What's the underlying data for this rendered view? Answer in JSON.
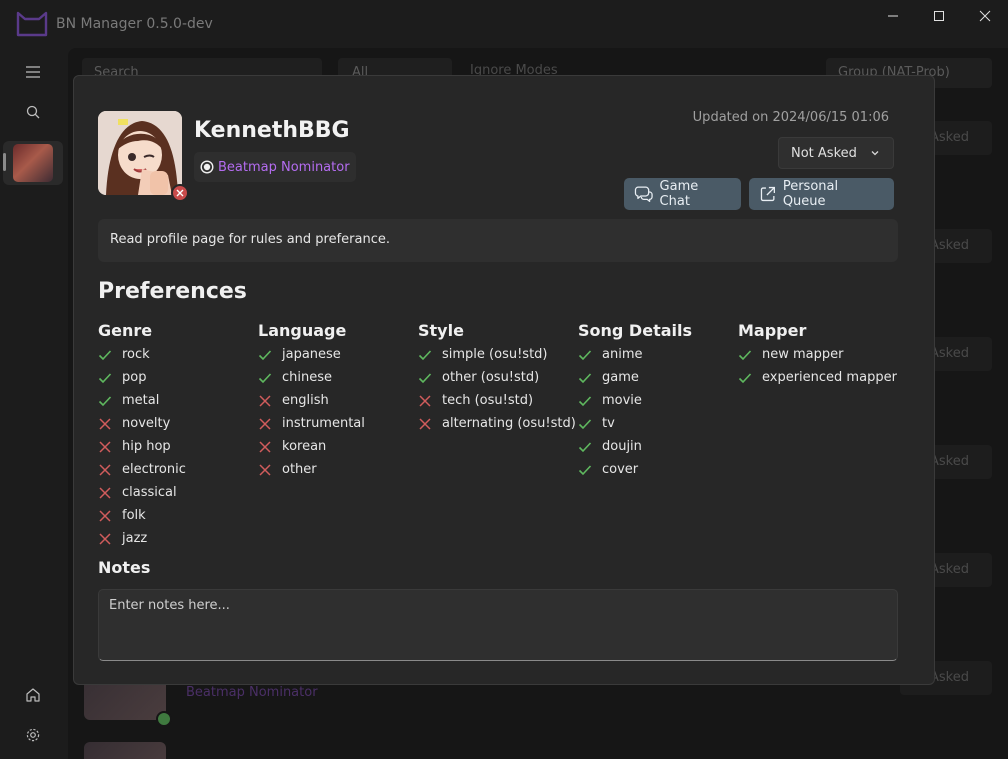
{
  "app": {
    "title": "BN Manager 0.5.0-dev"
  },
  "background": {
    "search_placeholder": "Search",
    "mode_filter": "All",
    "ignore_modes_label": "Ignore Modes",
    "group_filter": "Group (NAT-Prob)",
    "row_status_label": "Asked",
    "card_role": "Beatmap Nominator"
  },
  "profile": {
    "username": "KennethBBG",
    "role": "Beatmap Nominator",
    "updated": "Updated on 2024/06/15 01:06",
    "request_status": "Not Asked",
    "buttons": {
      "game_chat": "Game Chat",
      "personal_queue": "Personal Queue"
    },
    "bio": "Read profile page for rules and preferance."
  },
  "preferences": {
    "title": "Preferences",
    "columns": [
      {
        "name": "Genre",
        "items": [
          {
            "label": "rock",
            "ok": true
          },
          {
            "label": "pop",
            "ok": true
          },
          {
            "label": "metal",
            "ok": true
          },
          {
            "label": "novelty",
            "ok": false
          },
          {
            "label": "hip hop",
            "ok": false
          },
          {
            "label": "electronic",
            "ok": false
          },
          {
            "label": "classical",
            "ok": false
          },
          {
            "label": "folk",
            "ok": false
          },
          {
            "label": "jazz",
            "ok": false
          }
        ]
      },
      {
        "name": "Language",
        "items": [
          {
            "label": "japanese",
            "ok": true
          },
          {
            "label": "chinese",
            "ok": true
          },
          {
            "label": "english",
            "ok": false
          },
          {
            "label": "instrumental",
            "ok": false
          },
          {
            "label": "korean",
            "ok": false
          },
          {
            "label": "other",
            "ok": false
          }
        ]
      },
      {
        "name": "Style",
        "items": [
          {
            "label": "simple (osu!std)",
            "ok": true
          },
          {
            "label": "other (osu!std)",
            "ok": true
          },
          {
            "label": "tech (osu!std)",
            "ok": false
          },
          {
            "label": "alternating (osu!std)",
            "ok": false
          }
        ]
      },
      {
        "name": "Song Details",
        "items": [
          {
            "label": "anime",
            "ok": true
          },
          {
            "label": "game",
            "ok": true
          },
          {
            "label": "movie",
            "ok": true
          },
          {
            "label": "tv",
            "ok": true
          },
          {
            "label": "doujin",
            "ok": true
          },
          {
            "label": "cover",
            "ok": true
          }
        ]
      },
      {
        "name": "Mapper",
        "items": [
          {
            "label": "new mapper",
            "ok": true
          },
          {
            "label": "experienced mapper",
            "ok": true
          }
        ]
      }
    ]
  },
  "notes": {
    "title": "Notes",
    "placeholder": "Enter notes here...",
    "value": ""
  },
  "colors": {
    "accent_purple": "#b46cf0",
    "check_green": "#5fb85f",
    "cross_red": "#d15c5c",
    "button_bg": "#4a5a66",
    "status_offline": "#c94b4b"
  },
  "icons": {
    "check": "check-icon",
    "cross": "cross-icon",
    "chat": "chat-icon",
    "external": "external-link-icon",
    "chevron": "chevron-down-icon"
  }
}
